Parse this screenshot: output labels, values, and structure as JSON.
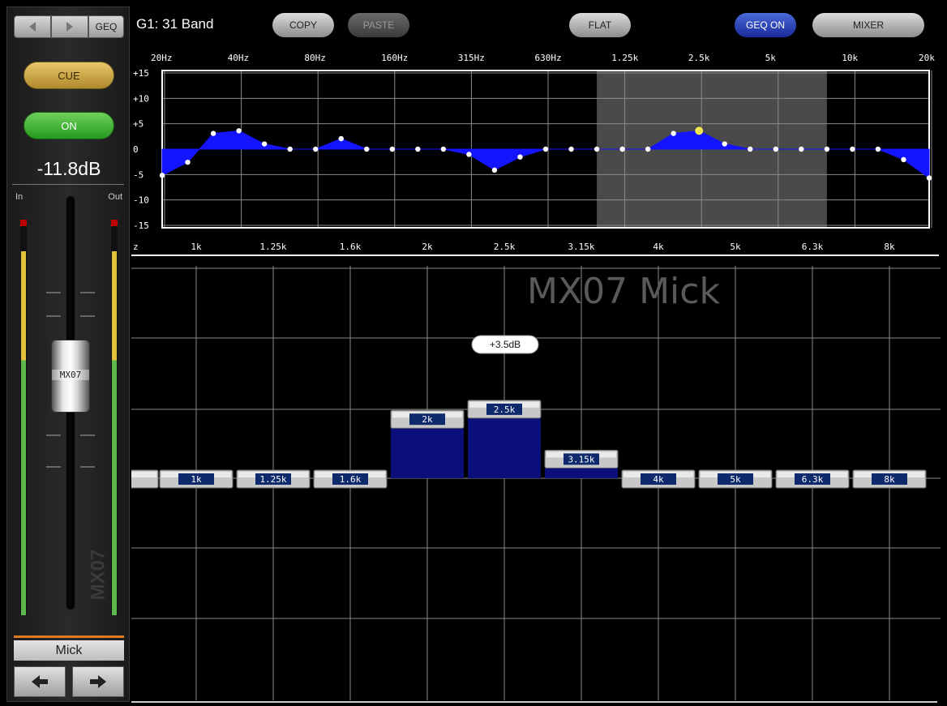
{
  "strip": {
    "nav_geq_label": "GEQ",
    "cue_label": "CUE",
    "on_label": "ON",
    "level": "-11.8dB",
    "in_label": "In",
    "out_label": "Out",
    "fader_cap_label": "MX07",
    "watermark": "MX07",
    "channel_name": "Mick",
    "meter_in_level": 0.92,
    "meter_out_level": 0.92
  },
  "toolbar": {
    "title": "G1: 31 Band",
    "copy_label": "COPY",
    "paste_label": "PASTE",
    "flat_label": "FLAT",
    "geq_on_label": "GEQ ON",
    "mixer_label": "MIXER"
  },
  "graph": {
    "top_freq_labels": [
      "20Hz",
      "40Hz",
      "80Hz",
      "160Hz",
      "315Hz",
      "630Hz",
      "1.25k",
      "2.5k",
      "5k",
      "10k",
      "20k"
    ],
    "db_labels": [
      "+15",
      "+10",
      "+5",
      "0",
      "-5",
      "-10",
      "-15"
    ],
    "bottom_freq_labels": [
      "z",
      "1k",
      "1.25k",
      "1.6k",
      "2k",
      "2.5k",
      "3.15k",
      "4k",
      "5k",
      "6.3k",
      "8k"
    ],
    "band_gains": [
      -5,
      -2.5,
      3,
      3.5,
      1,
      0,
      0,
      2,
      0,
      0,
      0,
      0,
      -1,
      -4,
      -1.5,
      0,
      0,
      0,
      0,
      0,
      3,
      3.5,
      1,
      0,
      0,
      0,
      0,
      0,
      0,
      -2,
      -5.5
    ],
    "selected_band": 21
  },
  "faders": {
    "watermark": "MX07 Mick",
    "value_tooltip": "+3.5dB",
    "bands": [
      {
        "label": "",
        "gain": 0
      },
      {
        "label": "1k",
        "gain": 0
      },
      {
        "label": "1.25k",
        "gain": 0
      },
      {
        "label": "1.6k",
        "gain": 0
      },
      {
        "label": "2k",
        "gain": 3
      },
      {
        "label": "2.5k",
        "gain": 3.5
      },
      {
        "label": "3.15k",
        "gain": 1
      },
      {
        "label": "4k",
        "gain": 0
      },
      {
        "label": "5k",
        "gain": 0
      },
      {
        "label": "6.3k",
        "gain": 0
      },
      {
        "label": "8k",
        "gain": 0
      }
    ]
  },
  "colors": {
    "curve_fill": "#1414ff",
    "dot": "#ffffff",
    "selected_dot": "#f2e650",
    "fader_fill": "#0a0f7a",
    "label_bg": "#0e2a6c"
  }
}
